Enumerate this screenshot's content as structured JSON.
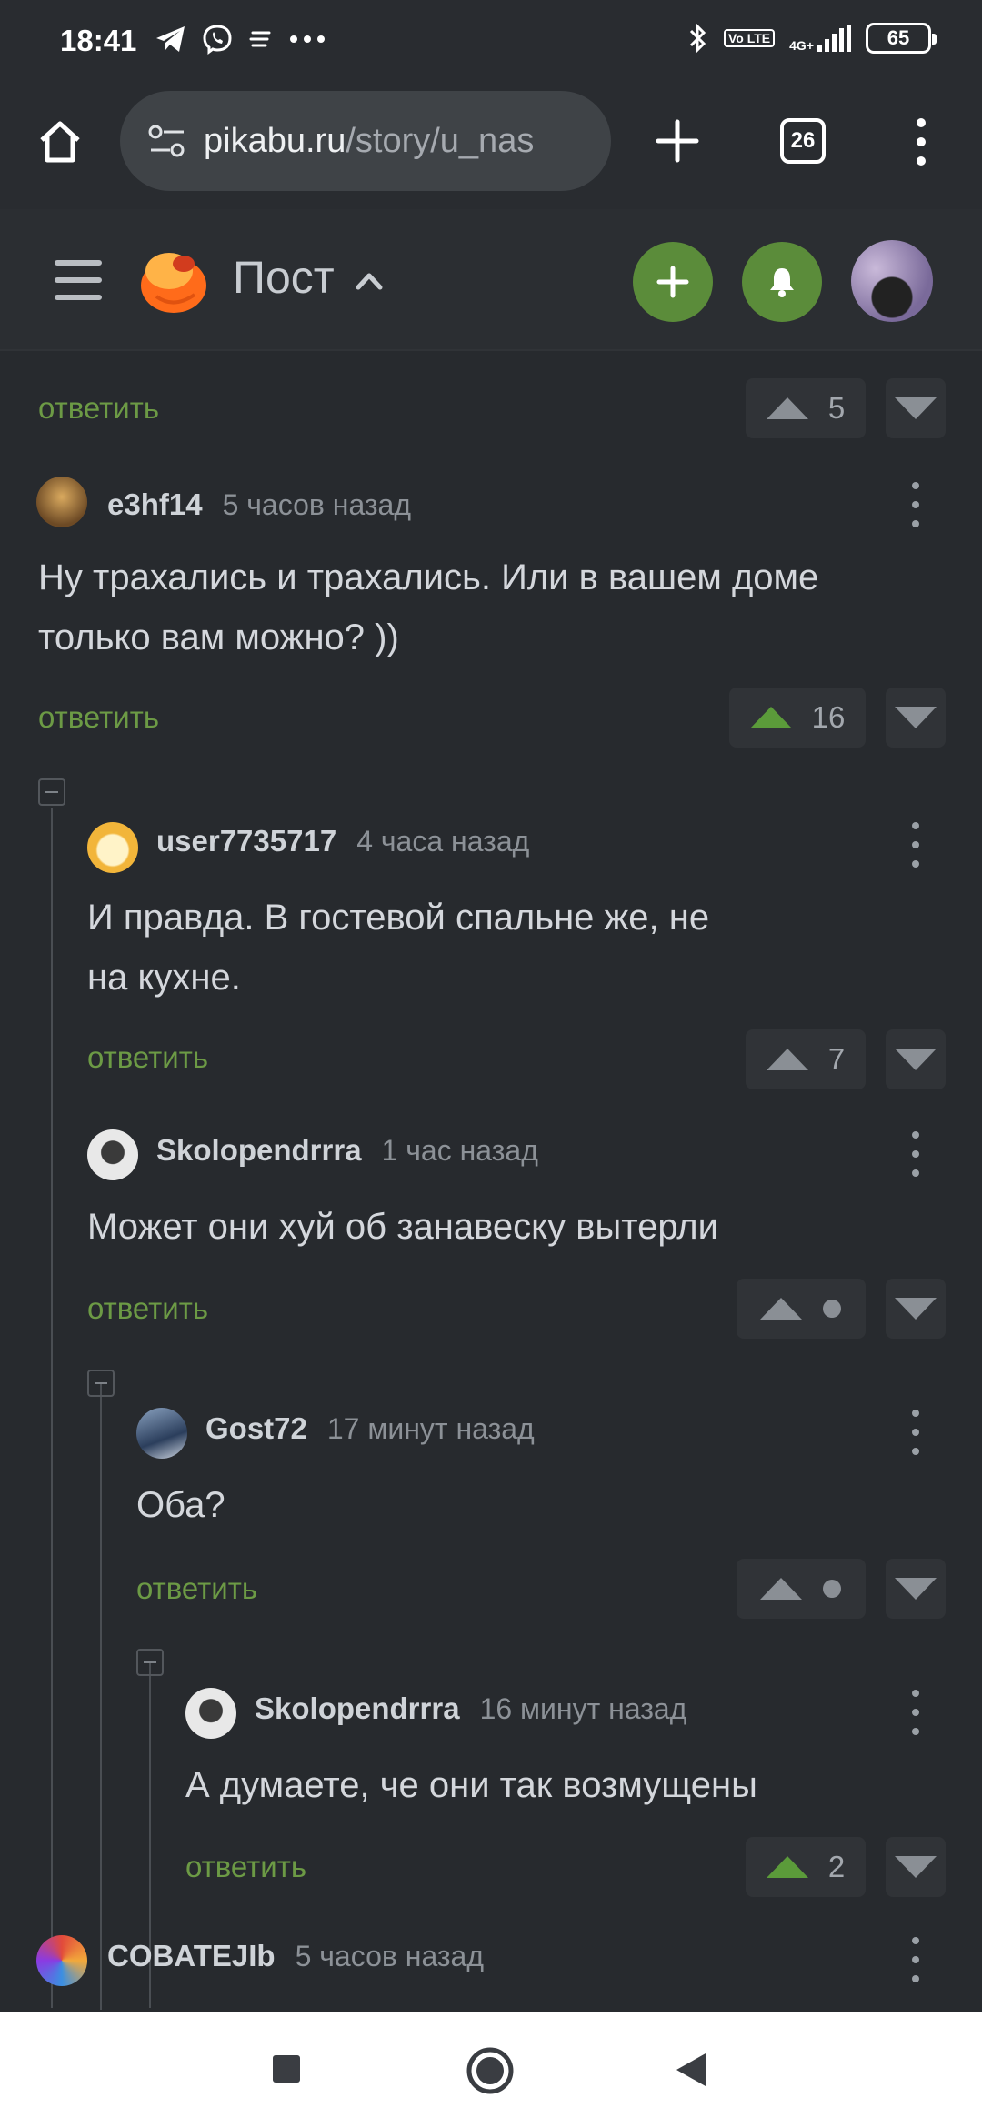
{
  "status": {
    "time": "18:41",
    "network": "4G+",
    "volte": "Vo LTE",
    "battery": "65"
  },
  "browser": {
    "url_domain": "pikabu.ru",
    "url_path": "/story/u_nas",
    "tab_count": "26"
  },
  "header": {
    "title": "Пост"
  },
  "comments": [
    {
      "reply_label": "ответить",
      "votes": "5"
    },
    {
      "username": "e3hf14",
      "time": "5 часов назад",
      "text_line1": "Ну трахались и трахались. Или в вашем доме",
      "text_line2": "только вам можно? ))",
      "reply_label": "ответить",
      "votes": "16"
    },
    {
      "username": "user7735717",
      "time": "4 часа назад",
      "text_line1": "И правда. В гостевой спальне же, не",
      "text_line2": "на кухне.",
      "reply_label": "ответить",
      "votes": "7"
    },
    {
      "username": "Skolopendrrra",
      "time": "1 час назад",
      "text_line1": "Может они хуй об занавеску вытерли",
      "reply_label": "ответить"
    },
    {
      "username": "Gost72",
      "time": "17 минут назад",
      "text_line1": "Оба?",
      "reply_label": "ответить"
    },
    {
      "username": "Skolopendrrra",
      "time": "16 минут назад",
      "text_line1": "А думаете, че они так возмущены",
      "reply_label": "ответить",
      "votes": "2"
    },
    {
      "username": "COBATEJIb",
      "time": "5 часов назад"
    }
  ],
  "colors": {
    "background": "#272a2e",
    "accent_green": "#5b8c3a",
    "reply_green": "#6c9a45",
    "upvote_active": "#5b9b3a"
  }
}
